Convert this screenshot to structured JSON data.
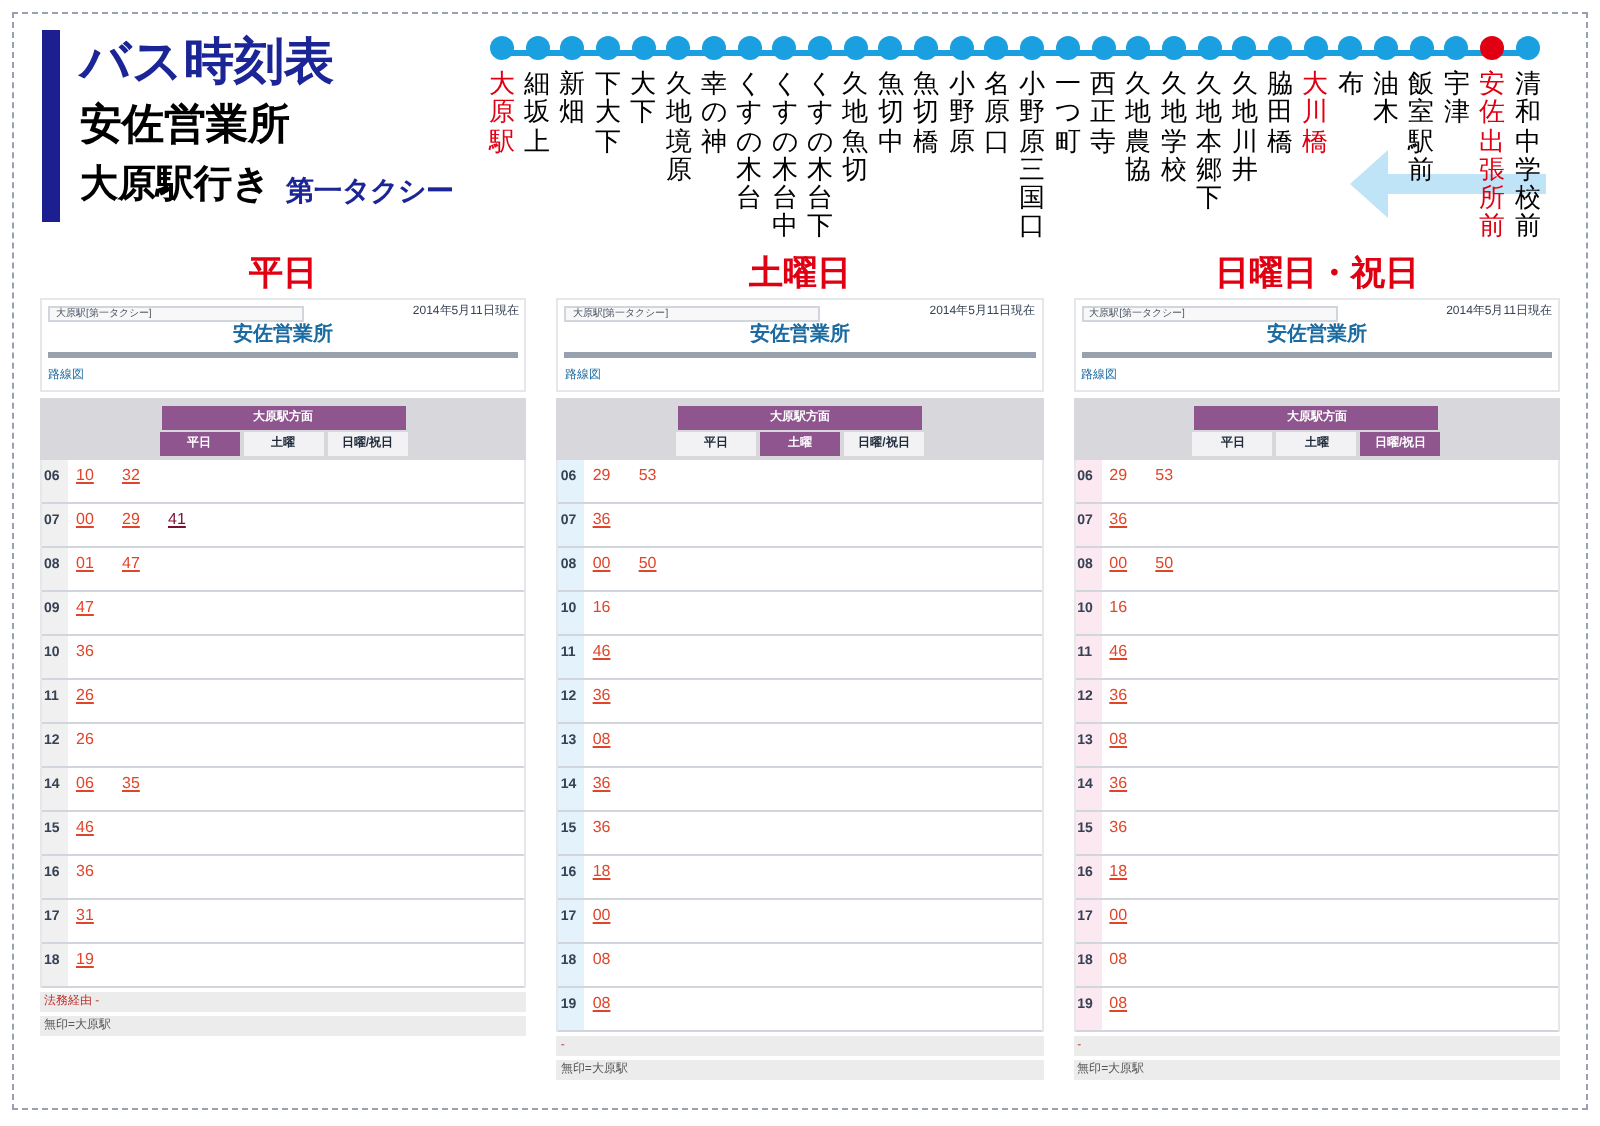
{
  "header": {
    "title": "バス時刻表",
    "office": "安佐営業所",
    "destination": "大原駅行き",
    "operator": "第一タクシー"
  },
  "route": {
    "stops": [
      {
        "name": "大原駅",
        "highlight": true
      },
      {
        "name": "細坂上",
        "highlight": false
      },
      {
        "name": "新畑",
        "highlight": false
      },
      {
        "name": "下大下",
        "highlight": false
      },
      {
        "name": "大下",
        "highlight": false
      },
      {
        "name": "久地境原",
        "highlight": false
      },
      {
        "name": "幸の神",
        "highlight": false
      },
      {
        "name": "くすの木台",
        "highlight": false
      },
      {
        "name": "くすの木台中",
        "highlight": false
      },
      {
        "name": "くすの木台下",
        "highlight": false
      },
      {
        "name": "久地魚切",
        "highlight": false
      },
      {
        "name": "魚切中",
        "highlight": false
      },
      {
        "name": "魚切橋",
        "highlight": false
      },
      {
        "name": "小野原",
        "highlight": false
      },
      {
        "name": "名原口",
        "highlight": false
      },
      {
        "name": "小野原三国口",
        "highlight": false
      },
      {
        "name": "一つ町",
        "highlight": false
      },
      {
        "name": "西正寺",
        "highlight": false
      },
      {
        "name": "久地農協",
        "highlight": false
      },
      {
        "name": "久地学校",
        "highlight": false
      },
      {
        "name": "久地本郷下",
        "highlight": false
      },
      {
        "name": "久地川井",
        "highlight": false
      },
      {
        "name": "脇田橋",
        "highlight": false
      },
      {
        "name": "大川橋",
        "highlight": true
      },
      {
        "name": "布",
        "highlight": false
      },
      {
        "name": "油木",
        "highlight": false
      },
      {
        "name": "飯室駅前",
        "highlight": false
      },
      {
        "name": "宇津",
        "highlight": false
      },
      {
        "name": "安佐出張所前",
        "highlight": true,
        "current": true
      },
      {
        "name": "清和中学校前",
        "highlight": false
      }
    ]
  },
  "panels": [
    {
      "heading": "平日",
      "kind": "weekday",
      "dropdown": "大原駅[第一タクシー]",
      "date": "2014年5月11日現在",
      "office": "安佐営業所",
      "route_link": "路線図",
      "direction": "大原駅方面",
      "tabs": [
        {
          "label": "平日",
          "selected": true
        },
        {
          "label": "土曜",
          "selected": false
        },
        {
          "label": "日曜/祝日",
          "selected": false
        }
      ],
      "rows": [
        {
          "hour": "06",
          "times": [
            {
              "text": "10",
              "kind": "link"
            },
            {
              "text": "32",
              "kind": "link"
            }
          ]
        },
        {
          "hour": "07",
          "times": [
            {
              "text": "00",
              "kind": "link"
            },
            {
              "text": "29",
              "kind": "link"
            },
            {
              "text": "41",
              "kind": "visited"
            }
          ]
        },
        {
          "hour": "08",
          "times": [
            {
              "text": "01",
              "kind": "link"
            },
            {
              "text": "47",
              "kind": "link"
            }
          ]
        },
        {
          "hour": "09",
          "times": [
            {
              "text": "47",
              "kind": "link"
            }
          ]
        },
        {
          "hour": "10",
          "times": [
            {
              "text": "36",
              "kind": "plain"
            }
          ]
        },
        {
          "hour": "11",
          "times": [
            {
              "text": "26",
              "kind": "link"
            }
          ]
        },
        {
          "hour": "12",
          "times": [
            {
              "text": "26",
              "kind": "plain"
            }
          ]
        },
        {
          "hour": "14",
          "times": [
            {
              "text": "06",
              "kind": "link"
            },
            {
              "text": "35",
              "kind": "link"
            }
          ]
        },
        {
          "hour": "15",
          "times": [
            {
              "text": "46",
              "kind": "link"
            }
          ]
        },
        {
          "hour": "16",
          "times": [
            {
              "text": "36",
              "kind": "plain"
            }
          ]
        },
        {
          "hour": "17",
          "times": [
            {
              "text": "31",
              "kind": "link"
            }
          ]
        },
        {
          "hour": "18",
          "times": [
            {
              "text": "19",
              "kind": "link"
            }
          ]
        }
      ],
      "notes": [
        {
          "text": "法務経由 -",
          "kind": "red"
        },
        {
          "text": "無印=大原駅",
          "kind": "gray"
        }
      ]
    },
    {
      "heading": "土曜日",
      "kind": "saturday",
      "dropdown": "大原駅[第一タクシー]",
      "date": "2014年5月11日現在",
      "office": "安佐営業所",
      "route_link": "路線図",
      "direction": "大原駅方面",
      "tabs": [
        {
          "label": "平日",
          "selected": false
        },
        {
          "label": "土曜",
          "selected": true
        },
        {
          "label": "日曜/祝日",
          "selected": false
        }
      ],
      "rows": [
        {
          "hour": "06",
          "times": [
            {
              "text": "29",
              "kind": "plain"
            },
            {
              "text": "53",
              "kind": "plain"
            }
          ]
        },
        {
          "hour": "07",
          "times": [
            {
              "text": "36",
              "kind": "link"
            }
          ]
        },
        {
          "hour": "08",
          "times": [
            {
              "text": "00",
              "kind": "link"
            },
            {
              "text": "50",
              "kind": "link"
            }
          ]
        },
        {
          "hour": "10",
          "times": [
            {
              "text": "16",
              "kind": "plain"
            }
          ]
        },
        {
          "hour": "11",
          "times": [
            {
              "text": "46",
              "kind": "link"
            }
          ]
        },
        {
          "hour": "12",
          "times": [
            {
              "text": "36",
              "kind": "link"
            }
          ]
        },
        {
          "hour": "13",
          "times": [
            {
              "text": "08",
              "kind": "link"
            }
          ]
        },
        {
          "hour": "14",
          "times": [
            {
              "text": "36",
              "kind": "link"
            }
          ]
        },
        {
          "hour": "15",
          "times": [
            {
              "text": "36",
              "kind": "plain"
            }
          ]
        },
        {
          "hour": "16",
          "times": [
            {
              "text": "18",
              "kind": "link"
            }
          ]
        },
        {
          "hour": "17",
          "times": [
            {
              "text": "00",
              "kind": "link"
            }
          ]
        },
        {
          "hour": "18",
          "times": [
            {
              "text": "08",
              "kind": "plain"
            }
          ]
        },
        {
          "hour": "19",
          "times": [
            {
              "text": "08",
              "kind": "link"
            }
          ]
        }
      ],
      "notes": [
        {
          "text": "-",
          "kind": "red"
        },
        {
          "text": "無印=大原駅",
          "kind": "gray"
        }
      ]
    },
    {
      "heading": "日曜日・祝日",
      "kind": "holiday",
      "dropdown": "大原駅[第一タクシー]",
      "date": "2014年5月11日現在",
      "office": "安佐営業所",
      "route_link": "路線図",
      "direction": "大原駅方面",
      "tabs": [
        {
          "label": "平日",
          "selected": false
        },
        {
          "label": "土曜",
          "selected": false
        },
        {
          "label": "日曜/祝日",
          "selected": true
        }
      ],
      "rows": [
        {
          "hour": "06",
          "times": [
            {
              "text": "29",
              "kind": "plain"
            },
            {
              "text": "53",
              "kind": "plain"
            }
          ]
        },
        {
          "hour": "07",
          "times": [
            {
              "text": "36",
              "kind": "link"
            }
          ]
        },
        {
          "hour": "08",
          "times": [
            {
              "text": "00",
              "kind": "link"
            },
            {
              "text": "50",
              "kind": "link"
            }
          ]
        },
        {
          "hour": "10",
          "times": [
            {
              "text": "16",
              "kind": "plain"
            }
          ]
        },
        {
          "hour": "11",
          "times": [
            {
              "text": "46",
              "kind": "link"
            }
          ]
        },
        {
          "hour": "12",
          "times": [
            {
              "text": "36",
              "kind": "link"
            }
          ]
        },
        {
          "hour": "13",
          "times": [
            {
              "text": "08",
              "kind": "link"
            }
          ]
        },
        {
          "hour": "14",
          "times": [
            {
              "text": "36",
              "kind": "link"
            }
          ]
        },
        {
          "hour": "15",
          "times": [
            {
              "text": "36",
              "kind": "plain"
            }
          ]
        },
        {
          "hour": "16",
          "times": [
            {
              "text": "18",
              "kind": "link"
            }
          ]
        },
        {
          "hour": "17",
          "times": [
            {
              "text": "00",
              "kind": "link"
            }
          ]
        },
        {
          "hour": "18",
          "times": [
            {
              "text": "08",
              "kind": "plain"
            }
          ]
        },
        {
          "hour": "19",
          "times": [
            {
              "text": "08",
              "kind": "link"
            }
          ]
        }
      ],
      "notes": [
        {
          "text": "-",
          "kind": "red"
        },
        {
          "text": "無印=大原駅",
          "kind": "gray"
        }
      ]
    }
  ]
}
